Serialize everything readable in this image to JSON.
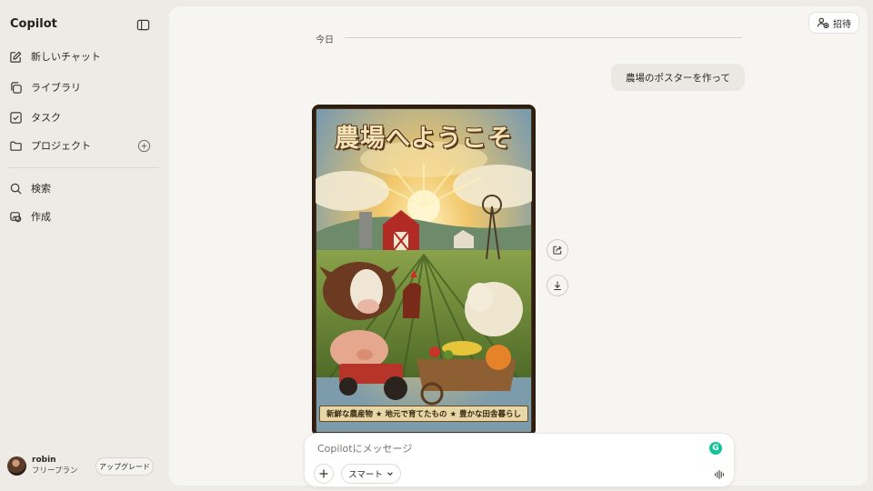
{
  "app": {
    "name": "Copilot"
  },
  "sidebar": {
    "items": [
      {
        "label": "新しいチャット",
        "icon": "new-chat-icon"
      },
      {
        "label": "ライブラリ",
        "icon": "library-icon"
      },
      {
        "label": "タスク",
        "icon": "task-icon"
      },
      {
        "label": "プロジェクト",
        "icon": "folder-icon"
      },
      {
        "label": "検索",
        "icon": "search-icon"
      },
      {
        "label": "作成",
        "icon": "create-icon"
      }
    ],
    "account": {
      "name": "robin",
      "plan": "フリープラン",
      "upgrade_label": "アップグレード"
    }
  },
  "header": {
    "invite_label": "招待"
  },
  "conversation": {
    "date_label": "今日",
    "user_message": "農場のポスターを作って",
    "poster": {
      "title": "農場へようこそ",
      "banner": "新鮮な農産物 ★ 地元で育てたもの ★ 豊かな田舎暮らし"
    }
  },
  "composer": {
    "placeholder": "Copilotにメッセージ",
    "mode_label": "スマート",
    "grammarly_letter": "G"
  },
  "colors": {
    "background": "#eeebe6",
    "panel": "#f7f5f1",
    "bubble": "#ebe8e3",
    "grammarly": "#15c39a"
  }
}
